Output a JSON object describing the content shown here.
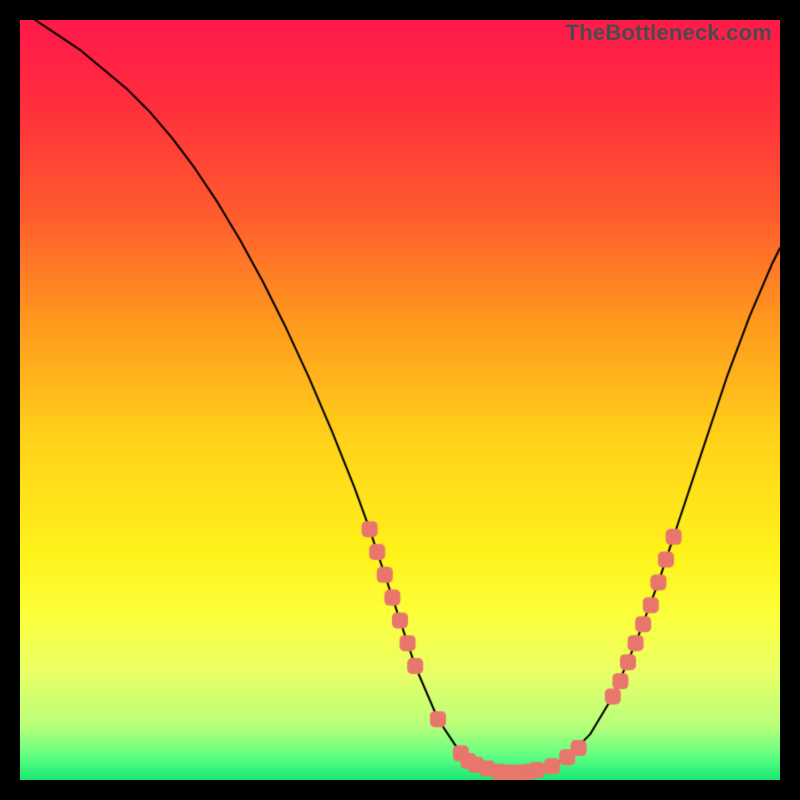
{
  "watermark": "TheBottleneck.com",
  "chart_data": {
    "type": "line",
    "title": "",
    "xlabel": "",
    "ylabel": "",
    "xlim": [
      0,
      100
    ],
    "ylim": [
      0,
      100
    ],
    "grid": false,
    "legend": false,
    "gradient_stops": [
      {
        "offset": 0.0,
        "color": "#ff1a4b"
      },
      {
        "offset": 0.1,
        "color": "#ff2b3f"
      },
      {
        "offset": 0.25,
        "color": "#ff5a2e"
      },
      {
        "offset": 0.4,
        "color": "#ff9a1e"
      },
      {
        "offset": 0.55,
        "color": "#ffd21a"
      },
      {
        "offset": 0.7,
        "color": "#fff21a"
      },
      {
        "offset": 0.78,
        "color": "#fcff3a"
      },
      {
        "offset": 0.86,
        "color": "#eaff68"
      },
      {
        "offset": 0.93,
        "color": "#b7ff7a"
      },
      {
        "offset": 0.97,
        "color": "#5dff82"
      },
      {
        "offset": 1.0,
        "color": "#17e873"
      }
    ],
    "series": [
      {
        "name": "curve",
        "stroke": "#000000",
        "stroke_width": 2.0,
        "x": [
          2,
          5,
          8,
          11,
          14,
          17,
          20,
          23,
          26,
          29,
          32,
          35,
          38,
          41,
          44,
          46,
          48,
          50,
          52,
          55,
          58,
          60,
          62,
          64,
          66,
          68,
          70,
          72,
          75,
          78,
          81,
          84,
          87,
          90,
          93,
          96,
          99,
          100
        ],
        "y": [
          100,
          98,
          96,
          93.5,
          91,
          88,
          84.5,
          80.5,
          76,
          71,
          65.5,
          59.5,
          53,
          46,
          38.5,
          33,
          27,
          21,
          15,
          8,
          3.5,
          2,
          1.2,
          1,
          1,
          1.2,
          1.8,
          3,
          6,
          11,
          18,
          26,
          35,
          44,
          53,
          61,
          68,
          70
        ]
      }
    ],
    "markers": {
      "color": "#e9766c",
      "size": 8,
      "shape": "rounded-square",
      "points": [
        {
          "x": 46.0,
          "y": 33.0
        },
        {
          "x": 47.0,
          "y": 30.0
        },
        {
          "x": 48.0,
          "y": 27.0
        },
        {
          "x": 49.0,
          "y": 24.0
        },
        {
          "x": 50.0,
          "y": 21.0
        },
        {
          "x": 51.0,
          "y": 18.0
        },
        {
          "x": 52.0,
          "y": 15.0
        },
        {
          "x": 55.0,
          "y": 8.0
        },
        {
          "x": 58.0,
          "y": 3.5
        },
        {
          "x": 59.0,
          "y": 2.5
        },
        {
          "x": 60.0,
          "y": 2.0
        },
        {
          "x": 61.5,
          "y": 1.5
        },
        {
          "x": 63.0,
          "y": 1.1
        },
        {
          "x": 64.5,
          "y": 1.0
        },
        {
          "x": 66.0,
          "y": 1.0
        },
        {
          "x": 67.0,
          "y": 1.1
        },
        {
          "x": 68.0,
          "y": 1.3
        },
        {
          "x": 70.0,
          "y": 1.8
        },
        {
          "x": 72.0,
          "y": 3.0
        },
        {
          "x": 73.5,
          "y": 4.2
        },
        {
          "x": 78.0,
          "y": 11.0
        },
        {
          "x": 79.0,
          "y": 13.0
        },
        {
          "x": 80.0,
          "y": 15.5
        },
        {
          "x": 81.0,
          "y": 18.0
        },
        {
          "x": 82.0,
          "y": 20.5
        },
        {
          "x": 83.0,
          "y": 23.0
        },
        {
          "x": 84.0,
          "y": 26.0
        },
        {
          "x": 85.0,
          "y": 29.0
        },
        {
          "x": 86.0,
          "y": 32.0
        }
      ]
    }
  }
}
